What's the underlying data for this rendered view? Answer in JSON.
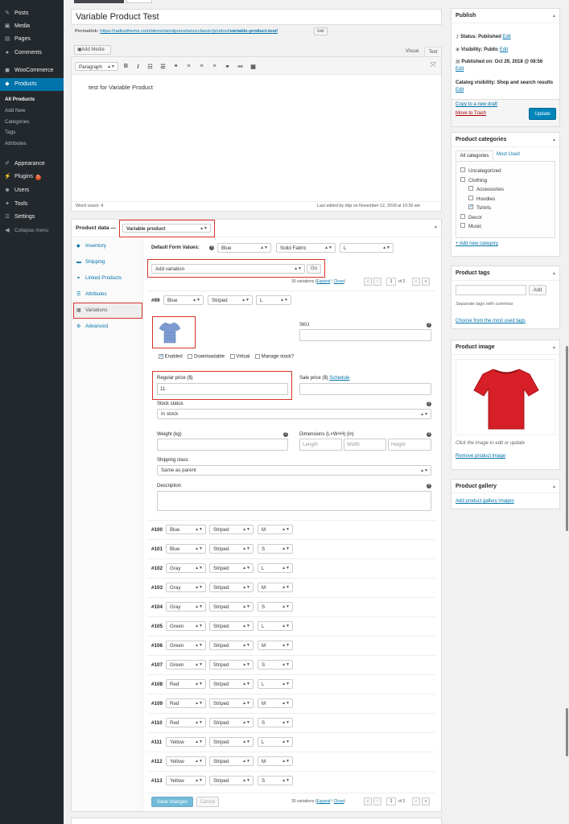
{
  "sidebar": {
    "items": [
      {
        "label": "Posts",
        "icon": "pin-icon"
      },
      {
        "label": "Media",
        "icon": "media-icon"
      },
      {
        "label": "Pages",
        "icon": "page-icon"
      },
      {
        "label": "Comments",
        "icon": "comment-icon"
      },
      {
        "label": "WooCommerce",
        "icon": "woocommerce-icon"
      },
      {
        "label": "Products",
        "icon": "products-icon"
      },
      {
        "label": "Appearance",
        "icon": "brush-icon"
      },
      {
        "label": "Plugins",
        "icon": "plugin-icon",
        "badge": "5"
      },
      {
        "label": "Users",
        "icon": "users-icon"
      },
      {
        "label": "Tools",
        "icon": "wrench-icon"
      },
      {
        "label": "Settings",
        "icon": "settings-icon"
      },
      {
        "label": "Collapse menu",
        "icon": "collapse-icon"
      }
    ],
    "products_sub": [
      "All Products",
      "Add New",
      "Categories",
      "Tags",
      "Attributes"
    ]
  },
  "post": {
    "title": "Variable Product Test",
    "permalink_label": "Permalink:",
    "permalink_base": "https://radiustheme.com/demo/wordpress/woocclassic/product/",
    "permalink_slug": "variable-product-test/",
    "edit_label": "Edit",
    "add_media": "Add Media",
    "tab_visual": "Visual",
    "tab_text": "Text",
    "format_select": "Paragraph",
    "content": "test for Variable Product",
    "word_count": "Word count: 4",
    "last_edited": "Last edited by rittp on November 12, 2018 at 10:39 am"
  },
  "product_data": {
    "label": "Product data —",
    "type": "Variable product",
    "tabs": [
      {
        "label": "Inventory",
        "icon": "diamond-icon"
      },
      {
        "label": "Shipping",
        "icon": "truck-icon"
      },
      {
        "label": "Linked Products",
        "icon": "link-icon"
      },
      {
        "label": "Attributes",
        "icon": "list-icon"
      },
      {
        "label": "Variations",
        "icon": "grid-icon"
      },
      {
        "label": "Advanced",
        "icon": "gear-icon"
      }
    ],
    "default_form_label": "Default Form Values:",
    "defaults": [
      "Blue",
      "Solid Fabric",
      "L"
    ],
    "add_variation": "Add variation",
    "go": "Go",
    "pager_text": "30 variations",
    "expand": "Expand",
    "close": "Close",
    "page_current": "1",
    "page_total": "of 2",
    "expanded": {
      "num": "#99",
      "color": "Blue",
      "pattern": "Striped",
      "size": "L",
      "sku_label": "SKU",
      "enabled": "Enabled",
      "downloadable": "Downloadable",
      "virtual": "Virtual",
      "manage_stock": "Manage stock?",
      "regular_label": "Regular price ($)",
      "regular_value": "11",
      "sale_label": "Sale price ($)",
      "schedule": "Schedule",
      "stock_label": "Stock status",
      "stock_value": "In stock",
      "weight_label": "Weight (kg)",
      "dims_label": "Dimensions (L×W×H) (in)",
      "length_ph": "Length",
      "width_ph": "Width",
      "height_ph": "Height",
      "ship_label": "Shipping class",
      "ship_value": "Same as parent",
      "desc_label": "Description"
    },
    "variations": [
      {
        "num": "#100",
        "color": "Blue",
        "pattern": "Striped",
        "size": "M"
      },
      {
        "num": "#101",
        "color": "Blue",
        "pattern": "Striped",
        "size": "S"
      },
      {
        "num": "#102",
        "color": "Gray",
        "pattern": "Striped",
        "size": "L"
      },
      {
        "num": "#103",
        "color": "Gray",
        "pattern": "Striped",
        "size": "M"
      },
      {
        "num": "#104",
        "color": "Gray",
        "pattern": "Striped",
        "size": "S"
      },
      {
        "num": "#105",
        "color": "Green",
        "pattern": "Striped",
        "size": "L"
      },
      {
        "num": "#106",
        "color": "Green",
        "pattern": "Striped",
        "size": "M"
      },
      {
        "num": "#107",
        "color": "Green",
        "pattern": "Striped",
        "size": "S"
      },
      {
        "num": "#108",
        "color": "Red",
        "pattern": "Striped",
        "size": "L"
      },
      {
        "num": "#109",
        "color": "Red",
        "pattern": "Striped",
        "size": "M"
      },
      {
        "num": "#110",
        "color": "Red",
        "pattern": "Striped",
        "size": "S"
      },
      {
        "num": "#111",
        "color": "Yellow",
        "pattern": "Striped",
        "size": "L"
      },
      {
        "num": "#112",
        "color": "Yellow",
        "pattern": "Striped",
        "size": "M"
      },
      {
        "num": "#113",
        "color": "Yellow",
        "pattern": "Striped",
        "size": "S"
      }
    ],
    "save_changes": "Save changes",
    "cancel": "Cancel"
  },
  "publish": {
    "title": "Publish",
    "status": "Status: Published",
    "status_edit": "Edit",
    "visibility": "Visibility: Public",
    "visibility_edit": "Edit",
    "published": "Published on: Oct 29, 2018 @ 08:56",
    "published_edit": "Edit",
    "catalog": "Catalog visibility: Shop and search results",
    "catalog_edit": "Edit",
    "copy": "Copy to a new draft",
    "trash": "Move to Trash",
    "update": "Update"
  },
  "categories": {
    "title": "Product categories",
    "tab_all": "All categories",
    "tab_used": "Most Used",
    "items": [
      {
        "label": "Uncategorized",
        "checked": false,
        "level": 0
      },
      {
        "label": "Clothing",
        "checked": false,
        "level": 0
      },
      {
        "label": "Accessories",
        "checked": false,
        "level": 1
      },
      {
        "label": "Hoodies",
        "checked": false,
        "level": 1
      },
      {
        "label": "Tshirts",
        "checked": true,
        "level": 1
      },
      {
        "label": "Decor",
        "checked": false,
        "level": 0
      },
      {
        "label": "Music",
        "checked": false,
        "level": 0
      }
    ],
    "add_new": "+ Add new category"
  },
  "tags": {
    "title": "Product tags",
    "add": "Add",
    "hint": "Separate tags with commas",
    "choose": "Choose from the most used tags"
  },
  "image": {
    "title": "Product image",
    "hint": "Click the image to edit or update",
    "remove": "Remove product image"
  },
  "gallery": {
    "title": "Product gallery",
    "add": "Add product gallery images"
  },
  "colors": {
    "accent": "#0073aa",
    "highlight": "#d9342b",
    "sidebar": "#23282d",
    "tshirt_red": "#d61f26",
    "tshirt_blue": "#7e9bd0"
  }
}
